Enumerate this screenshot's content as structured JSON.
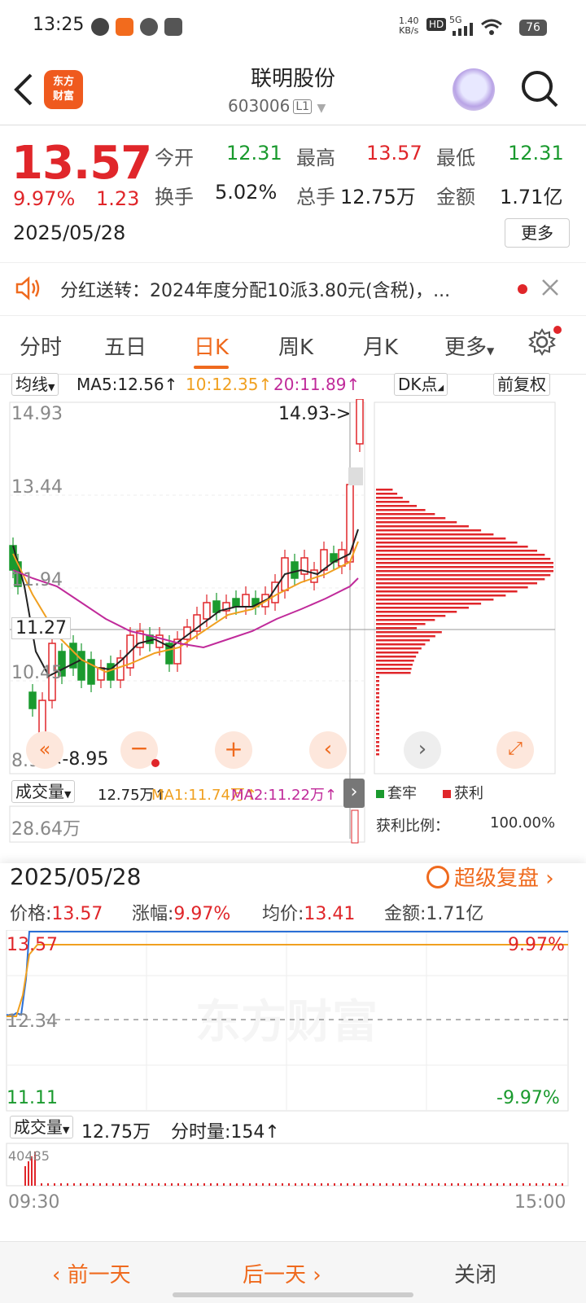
{
  "status_bar": {
    "time": "13:25",
    "net_speed_value": "1.40",
    "net_speed_unit": "KB/s",
    "hd": "HD",
    "signal": "5G",
    "battery": "76"
  },
  "header": {
    "logo_line1": "东方",
    "logo_line2": "财富",
    "stock_name": "联明股份",
    "stock_code": "603006",
    "level_badge": "L1"
  },
  "quote": {
    "price": "13.57",
    "change_pct": "9.97%",
    "change_amt": "1.23",
    "date": "2025/05/28",
    "open_label": "今开",
    "open": "12.31",
    "high_label": "最高",
    "high": "13.57",
    "low_label": "最低",
    "low": "12.31",
    "turnover_label": "换手",
    "turnover": "5.02%",
    "volume_label": "总手",
    "volume": "12.75万",
    "amount_label": "金额",
    "amount": "1.71亿",
    "more_button": "更多"
  },
  "notice": {
    "text": "分红送转：2024年度分配10派3.80元(含税)，..."
  },
  "tabs": [
    "分时",
    "五日",
    "日K",
    "周K",
    "月K",
    "更多"
  ],
  "active_tab": 2,
  "kline": {
    "indicator_select": "均线",
    "ma5": "MA5:12.56",
    "ma10": "10:12.35",
    "ma20": "20:11.89",
    "dk_button": "DK点",
    "adjust_button": "前复权",
    "y_labels": [
      "14.93",
      "13.44",
      "11.94",
      "10.45",
      "8.95"
    ],
    "max_marker": "14.93->",
    "min_marker": "<-8.95",
    "crosshair_value": "11.27",
    "volume_select": "成交量",
    "vol_value": "12.75万",
    "vol_ma1": "MA1:11.74万",
    "vol_ma2": "MA2:11.22万",
    "vol_max": "28.64万",
    "legend_trapped": "套牢",
    "legend_profit": "获利",
    "profit_ratio_label": "获利比例：",
    "profit_ratio_value": "100.00%",
    "colors": {
      "up": "#e0262a",
      "down": "#1a9a2e",
      "ma5": "#222222",
      "ma10": "#f0a020",
      "ma20": "#c02a9a"
    }
  },
  "review": {
    "date": "2025/05/28",
    "super_review": "超级复盘",
    "price_label": "价格:",
    "price": "13.57",
    "change_label": "涨幅:",
    "change": "9.97%",
    "avg_label": "均价:",
    "avg": "13.41",
    "amount_label": "金额:",
    "amount": "1.71亿",
    "y_top": "13.57",
    "y_mid": "12.34",
    "y_bottom": "11.11",
    "pct_top": "9.97%",
    "pct_bottom": "-9.97%",
    "watermark": "东方财富",
    "volume_select": "成交量",
    "volume_total": "12.75万",
    "tick_volume": "分时量:154",
    "vol_max": "40485",
    "time_start": "09:30",
    "time_end": "15:00"
  },
  "bottom_bar": {
    "prev_day": "前一天",
    "next_day": "后一天",
    "close": "关闭"
  }
}
